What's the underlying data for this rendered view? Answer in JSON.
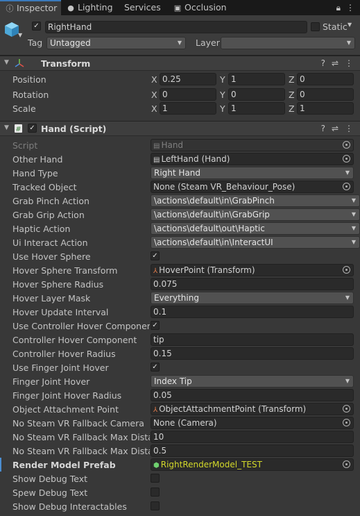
{
  "tabs": [
    {
      "label": "Inspector",
      "icon": "info-icon",
      "active": true
    },
    {
      "label": "Lighting",
      "icon": "bulb-icon",
      "active": false
    },
    {
      "label": "Services",
      "icon": "",
      "active": false
    },
    {
      "label": "Occlusion",
      "icon": "window-icon",
      "active": false
    }
  ],
  "object": {
    "name": "RightHand",
    "static_label": "Static",
    "tag_label": "Tag",
    "tag_value": "Untagged",
    "layer_label": "Layer",
    "layer_value": ""
  },
  "transform": {
    "title": "Transform",
    "rows": [
      {
        "label": "Position",
        "x": "0.25",
        "y": "1",
        "z": "0"
      },
      {
        "label": "Rotation",
        "x": "0",
        "y": "0",
        "z": "0"
      },
      {
        "label": "Scale",
        "x": "1",
        "y": "1",
        "z": "1"
      }
    ],
    "axis_x": "X",
    "axis_y": "Y",
    "axis_z": "Z"
  },
  "script": {
    "title": "Hand (Script)",
    "rows": [
      {
        "label": "Script",
        "kind": "object",
        "value": "Hand",
        "icon": "script-icon",
        "disabled": true
      },
      {
        "label": "Other Hand",
        "kind": "object",
        "value": "LeftHand (Hand)",
        "icon": "script-icon"
      },
      {
        "label": "Hand Type",
        "kind": "dropdown",
        "value": "Right Hand"
      },
      {
        "label": "Tracked Object",
        "kind": "object",
        "value": "None (Steam VR_Behaviour_Pose)"
      },
      {
        "label": "Grab Pinch Action",
        "kind": "dropdown",
        "value": "\\actions\\default\\in\\GrabPinch"
      },
      {
        "label": "Grab Grip Action",
        "kind": "dropdown",
        "value": "\\actions\\default\\in\\GrabGrip"
      },
      {
        "label": "Haptic Action",
        "kind": "dropdown",
        "value": "\\actions\\default\\out\\Haptic"
      },
      {
        "label": "Ui Interact Action",
        "kind": "dropdown",
        "value": "\\actions\\default\\in\\InteractUI"
      },
      {
        "label": "Use Hover Sphere",
        "kind": "check",
        "value": "✓"
      },
      {
        "label": "Hover Sphere Transform",
        "kind": "object",
        "value": "HoverPoint (Transform)",
        "icon": "transform-icon"
      },
      {
        "label": "Hover Sphere Radius",
        "kind": "text",
        "value": "0.075"
      },
      {
        "label": "Hover Layer Mask",
        "kind": "dropdown",
        "value": "Everything"
      },
      {
        "label": "Hover Update Interval",
        "kind": "text",
        "value": "0.1"
      },
      {
        "label": "Use Controller Hover Component",
        "kind": "check",
        "value": "✓"
      },
      {
        "label": "Controller Hover Component",
        "kind": "text",
        "value": "tip"
      },
      {
        "label": "Controller Hover Radius",
        "kind": "text",
        "value": "0.15"
      },
      {
        "label": "Use Finger Joint Hover",
        "kind": "check",
        "value": "✓"
      },
      {
        "label": "Finger Joint Hover",
        "kind": "dropdown",
        "value": "Index Tip"
      },
      {
        "label": "Finger Joint Hover Radius",
        "kind": "text",
        "value": "0.05"
      },
      {
        "label": "Object Attachment Point",
        "kind": "object",
        "value": "ObjectAttachmentPoint (Transform)",
        "icon": "transform-icon"
      },
      {
        "label": "No Steam VR Fallback Camera",
        "kind": "object",
        "value": "None (Camera)"
      },
      {
        "label": "No Steam VR Fallback Max Distance",
        "kind": "text",
        "value": "10"
      },
      {
        "label": "No Steam VR Fallback Max Distance",
        "kind": "text",
        "value": "0.5"
      },
      {
        "label": "Render Model Prefab",
        "kind": "object",
        "value": "RightRenderModel_TEST",
        "icon": "prefab-icon",
        "bold": true,
        "highlight": true
      },
      {
        "label": "Show Debug Text",
        "kind": "check",
        "value": ""
      },
      {
        "label": "Spew Debug Text",
        "kind": "check",
        "value": ""
      },
      {
        "label": "Show Debug Interactables",
        "kind": "check",
        "value": ""
      }
    ]
  },
  "colors": {
    "background": "#383838",
    "accent": "#3a79bb",
    "highlight": "#d3d92a",
    "modified_marker": "#4b8dd0"
  }
}
